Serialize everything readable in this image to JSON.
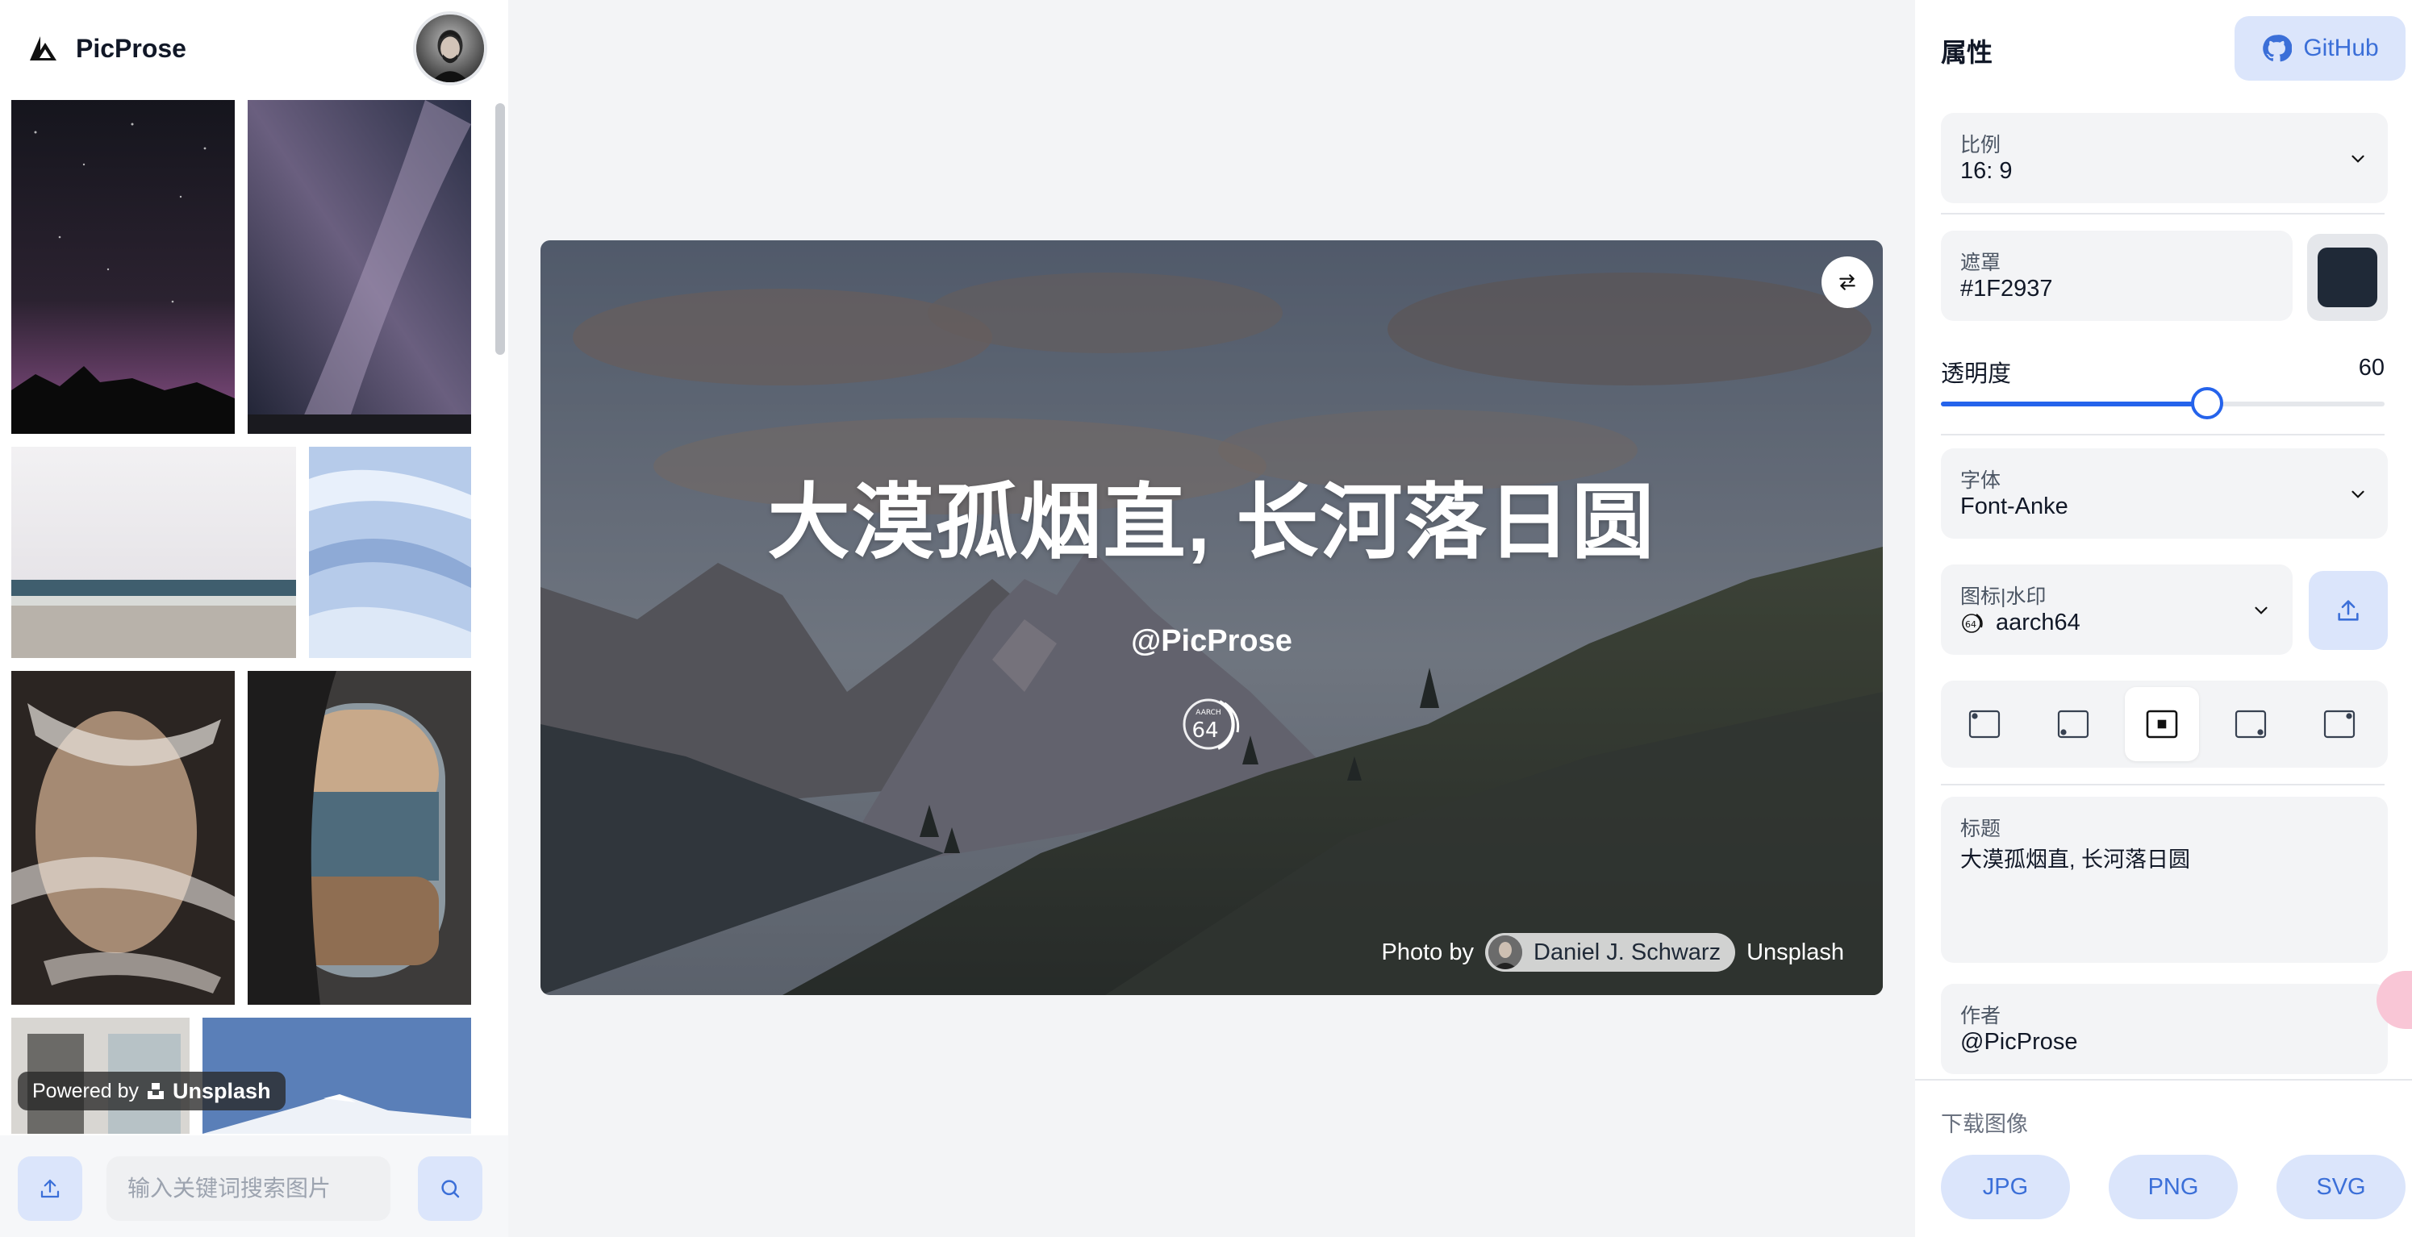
{
  "brand": {
    "name": "PicProse"
  },
  "left": {
    "powered_prefix": "Powered by",
    "powered_brand": "Unsplash",
    "search_placeholder": "输入关键词搜索图片"
  },
  "canvas": {
    "title": "大漠孤烟直, 长河落日圆",
    "author": "@PicProse",
    "icon_text_top": "AARCH",
    "icon_text_num": "64",
    "credit_prefix": "Photo by",
    "credit_name": "Daniel J. Schwarz",
    "credit_source": "Unsplash"
  },
  "panel": {
    "title": "属性",
    "github_label": "GitHub",
    "ratio": {
      "label": "比例",
      "value": "16: 9"
    },
    "mask": {
      "label": "遮罩",
      "value": "#1F2937",
      "color": "#1F2937"
    },
    "opacity": {
      "label": "透明度",
      "value": "60",
      "level": 0.6
    },
    "font": {
      "label": "字体",
      "value": "Font-Anke"
    },
    "icon": {
      "label": "图标|水印",
      "value": "aarch64"
    },
    "heading": {
      "label": "标题",
      "value": "大漠孤烟直, 长河落日圆"
    },
    "author": {
      "label": "作者",
      "value": "@PicProse"
    },
    "download": {
      "label": "下载图像",
      "jpg": "JPG",
      "png": "PNG",
      "svg": "SVG"
    }
  },
  "colors": {
    "accent": "#2563eb",
    "accent_soft": "#dbe5fb",
    "accent_text": "#3b6fd8",
    "mask": "#1F2937"
  }
}
